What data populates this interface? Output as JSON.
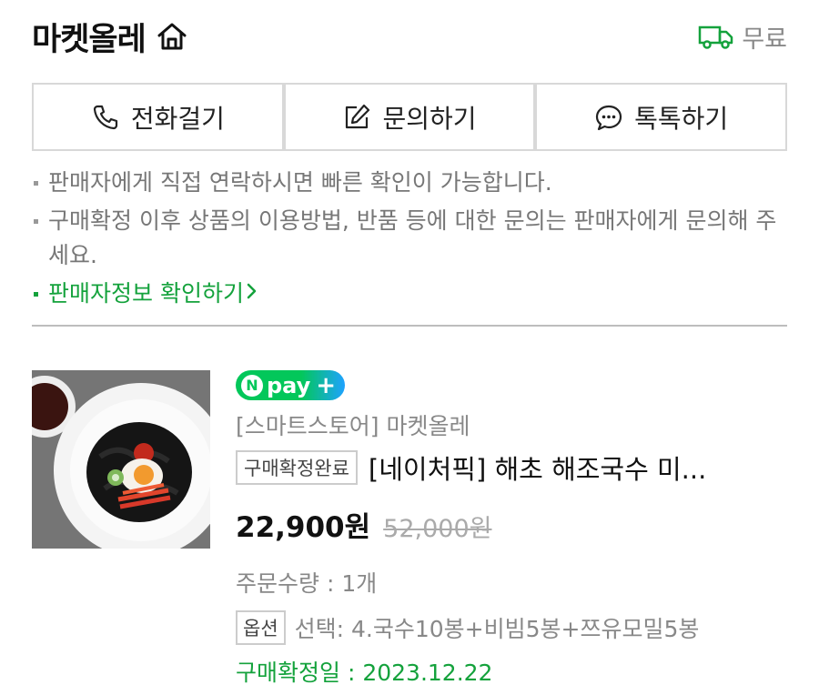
{
  "header": {
    "store_name": "마켓올레",
    "shipping_label": "무료"
  },
  "buttons": {
    "call": "전화걸기",
    "inquiry": "문의하기",
    "talktalk": "톡톡하기"
  },
  "notices": [
    "판매자에게 직접 연락하시면 빠른 확인이 가능합니다.",
    "구매확정 이후 상품의 이용방법, 반품 등에 대한 문의는 판매자에게 문의해 주세요."
  ],
  "seller_link": "판매자정보 확인하기",
  "product": {
    "npay_label": "pay",
    "seller": "[스마트스토어] 마켓올레",
    "status_badge": "구매확정완료",
    "name": "[네이처픽] 해초 해조국수 미...",
    "price": "22,900원",
    "original_price": "52,000원",
    "quantity": "주문수량 : 1개",
    "option_badge": "옵션",
    "option_text": "선택: 4.국수10봉+비빔5봉+쯔유모밀5봉",
    "confirm_date": "구매확정일 : 2023.12.22"
  },
  "colors": {
    "accent_green": "#14a23c",
    "npay_green": "#03c75a"
  }
}
